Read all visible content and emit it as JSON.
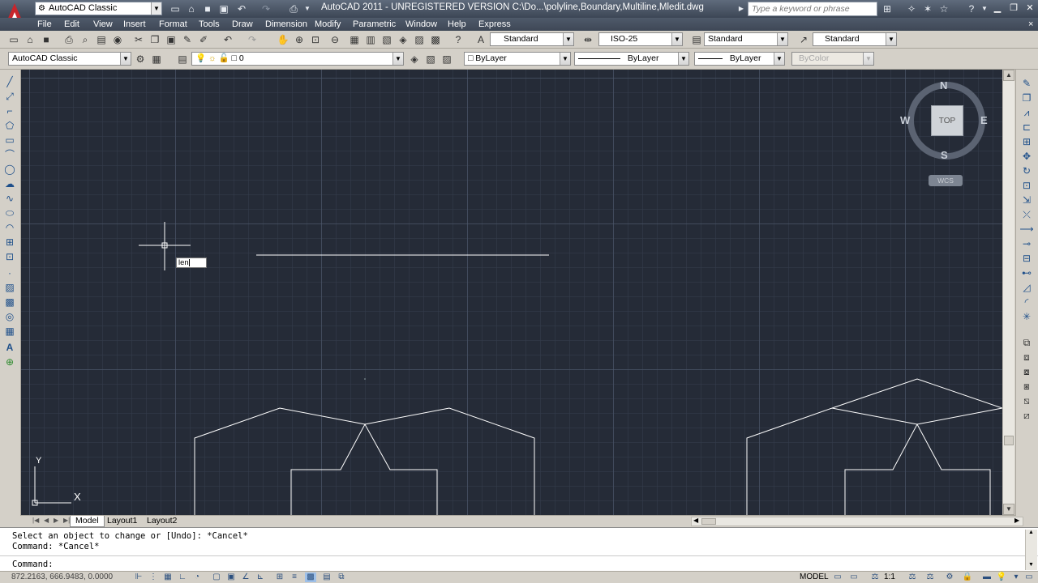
{
  "titlebar": {
    "workspace": "AutoCAD Classic",
    "title": "AutoCAD 2011 - UNREGISTERED VERSION    C:\\Do...\\polyline,Boundary,Multiline,Mledit.dwg",
    "search_placeholder": "Type a keyword or phrase"
  },
  "menu": [
    "File",
    "Edit",
    "View",
    "Insert",
    "Format",
    "Tools",
    "Draw",
    "Dimension",
    "Modify",
    "Parametric",
    "Window",
    "Help",
    "Express"
  ],
  "styles_toolbar": {
    "text_style": "Standard",
    "dim_style": "ISO-25",
    "table_style": "Standard",
    "multileader_style": "Standard"
  },
  "layers_toolbar": {
    "workspace": "AutoCAD Classic",
    "layer": "0",
    "color": "ByLayer",
    "linetype": "ByLayer",
    "lineweight": "ByLayer",
    "plotstyle": "ByColor"
  },
  "viewcube": {
    "north": "N",
    "south": "S",
    "east": "E",
    "west": "W",
    "face": "TOP",
    "ucs": "WCS"
  },
  "ucs_icon": {
    "x": "X",
    "y": "Y"
  },
  "dynamic_input": "len",
  "tabs": [
    "Model",
    "Layout1",
    "Layout2"
  ],
  "command": {
    "line1": "Select an object to change or [Undo]: *Cancel*",
    "line2": "Command: *Cancel*",
    "prompt": "Command:"
  },
  "status": {
    "coords": "872.2163, 666.9483, 0.0000",
    "space": "MODEL",
    "scale": "1:1"
  }
}
